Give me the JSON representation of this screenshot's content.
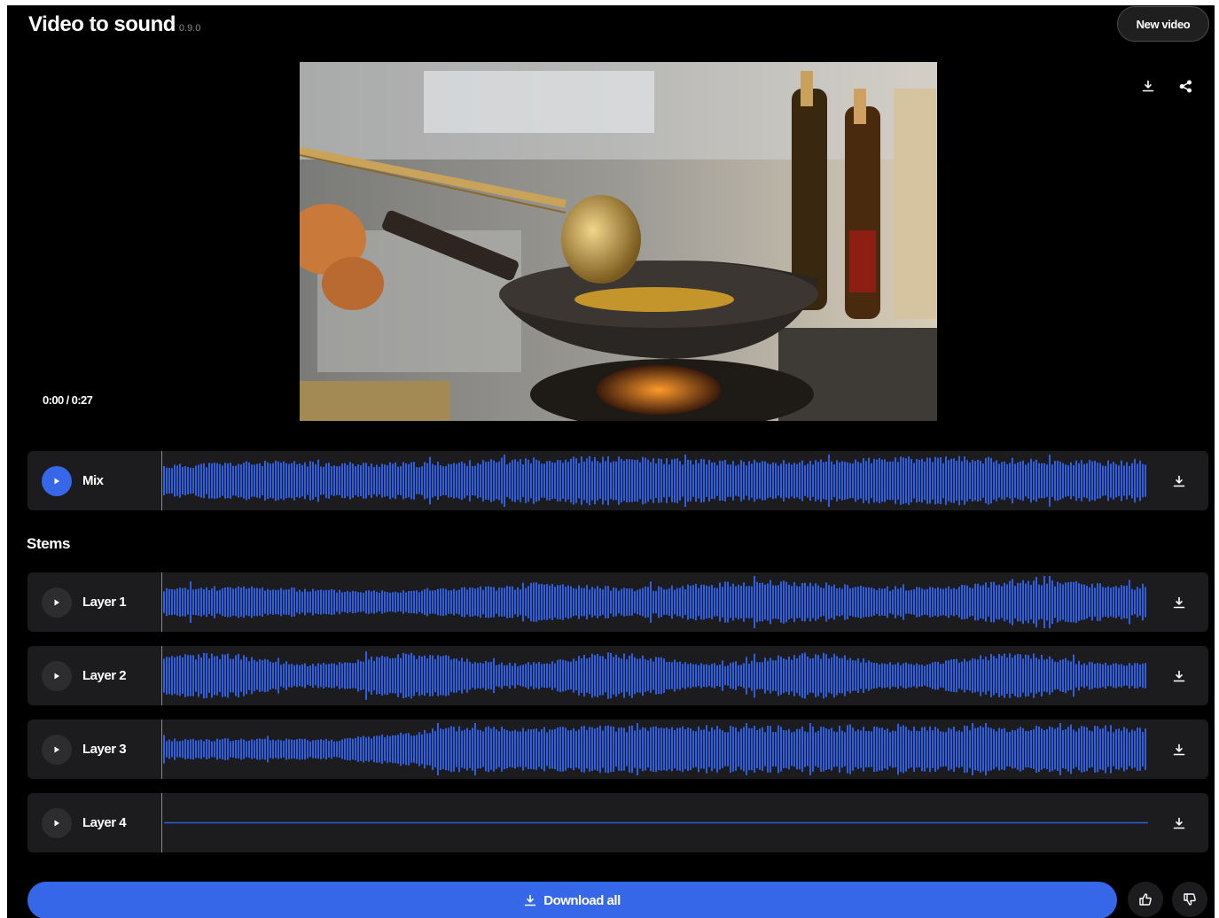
{
  "app": {
    "title": "Video to sound",
    "version": "0.9.0"
  },
  "header": {
    "new_video_label": "New video"
  },
  "video": {
    "timecode": "0:00 / 0:27"
  },
  "mix": {
    "label": "Mix"
  },
  "stems": {
    "heading": "Stems",
    "layers": [
      {
        "label": "Layer 1"
      },
      {
        "label": "Layer 2"
      },
      {
        "label": "Layer 3"
      },
      {
        "label": "Layer 4"
      }
    ]
  },
  "footer": {
    "download_all_label": "Download all"
  },
  "icons": {
    "download": "download-icon",
    "share": "share-icon",
    "play": "play-icon",
    "thumbs_up": "thumbs-up-icon",
    "thumbs_down": "thumbs-down-icon"
  },
  "colors": {
    "accent": "#3567e8",
    "waveform": "#2f5fe0",
    "track_bg": "#1c1c1e",
    "background": "#000000"
  }
}
